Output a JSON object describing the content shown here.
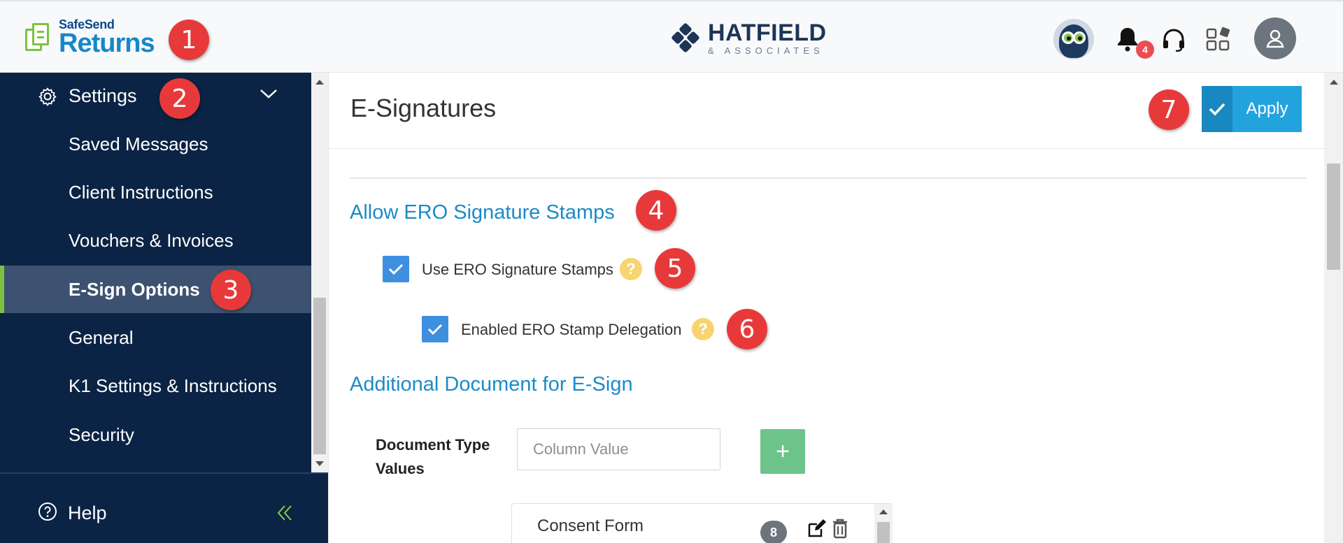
{
  "header": {
    "brand_small": "SafeSend",
    "brand_big": "Returns",
    "company_name": "HATFIELD",
    "company_sub": "& ASSOCIATES",
    "notification_count": "4",
    "icons": [
      "safesend-logo-icon",
      "owl-avatar-icon",
      "bell-icon",
      "headset-icon",
      "apps-grid-icon",
      "user-icon"
    ]
  },
  "annotations": [
    "1",
    "2",
    "3",
    "4",
    "5",
    "6",
    "7",
    "8"
  ],
  "sidebar": {
    "settings_label": "Settings",
    "items": [
      {
        "label": "Saved Messages",
        "active": false
      },
      {
        "label": "Client Instructions",
        "active": false
      },
      {
        "label": "Vouchers & Invoices",
        "active": false
      },
      {
        "label": "E-Sign Options",
        "active": true
      },
      {
        "label": "General",
        "active": false
      },
      {
        "label": "K1 Settings & Instructions",
        "active": false
      },
      {
        "label": "Security",
        "active": false
      }
    ],
    "help_label": "Help"
  },
  "main": {
    "page_title": "E-Signatures",
    "apply_label": "Apply",
    "section_ero": {
      "title": "Allow ERO Signature Stamps",
      "use_stamps_label": "Use ERO Signature Stamps",
      "use_stamps_checked": true,
      "delegation_label": "Enabled ERO Stamp Delegation",
      "delegation_checked": true,
      "help_glyph": "?"
    },
    "section_docs": {
      "title": "Additional Document for E-Sign",
      "doc_type_label_line1": "Document Type",
      "doc_type_label_line2": "Values",
      "input_placeholder": "Column Value",
      "add_glyph": "+",
      "items": [
        {
          "label": "Consent Form"
        }
      ]
    }
  },
  "colors": {
    "sidebar_bg": "#0b2344",
    "active_accent": "#7cc142",
    "section_title": "#1b8bc7",
    "apply_bg": "#23a3dd",
    "annotation_badge": "#e8393a"
  }
}
